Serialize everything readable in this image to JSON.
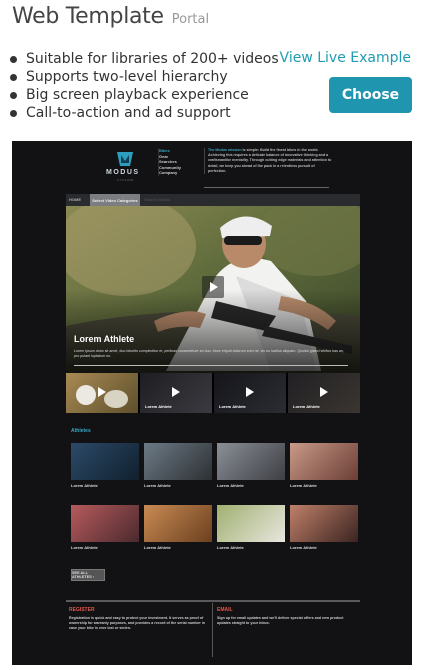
{
  "header": {
    "title": "Web Template",
    "subtitle": "Portal"
  },
  "features": [
    "Suitable for libraries of 200+ videos",
    "Supports two-level hierarchy",
    "Big screen playback experience",
    "Call-to-action and ad support"
  ],
  "actions": {
    "live_link": "View Live Example",
    "choose": "Choose"
  },
  "accent": "#1f95b0",
  "preview": {
    "logo": "MODUS",
    "logo_sub": "CYCLING",
    "nav": [
      "Bikes",
      "Gear",
      "Searches",
      "Community",
      "Company"
    ],
    "about_highlight": "The Modus mission",
    "about_text": " is simple: Build the finest bikes in the world. Achieving this requires a delicate balance of innovative thinking and a craftsmanlike mentality. Through cutting edge materials and attention to detail, we keep you ahead of the pack in a relentless pursuit of perfection.",
    "bar": {
      "home": "HOME",
      "category": "Select Video Categories",
      "search": "Search Videos"
    },
    "hero": {
      "title": "Lorem Athlete",
      "description": "Lorem ipsum dolor sit amet, duo lobortis complectitur et, pertinax consectetuer an duo. Iriure eripuit dolorum eum ne, vis eu lucilius aliquam. Quodsi graeci veritus has an, pro putant luptatum no."
    },
    "strip": [
      {
        "label": ""
      },
      {
        "label": "Lorem Athlete"
      },
      {
        "label": "Lorem Athlete"
      },
      {
        "label": "Lorem Athlete"
      }
    ],
    "section_title": "Athletes",
    "tiles": [
      "Lorem Athlete",
      "Lorem Athlete",
      "Lorem Athlete",
      "Lorem Athlete",
      "Lorem Athlete",
      "Lorem Athlete",
      "Lorem Athlete",
      "Lorem Athlete"
    ],
    "see_all": "SEE ALL ATHLETES  ›",
    "footer": {
      "register_title": "REGISTER",
      "register_text": "Registration is quick and easy to protect your investment. It serves as proof of ownership for warranty purposes, and provides a record of the serial number in case your bike is ever lost or stolen.",
      "email_title": "EMAIL",
      "email_text": "Sign up for email updates and we'll deliver special offers and new product updates straight to your inbox."
    }
  }
}
